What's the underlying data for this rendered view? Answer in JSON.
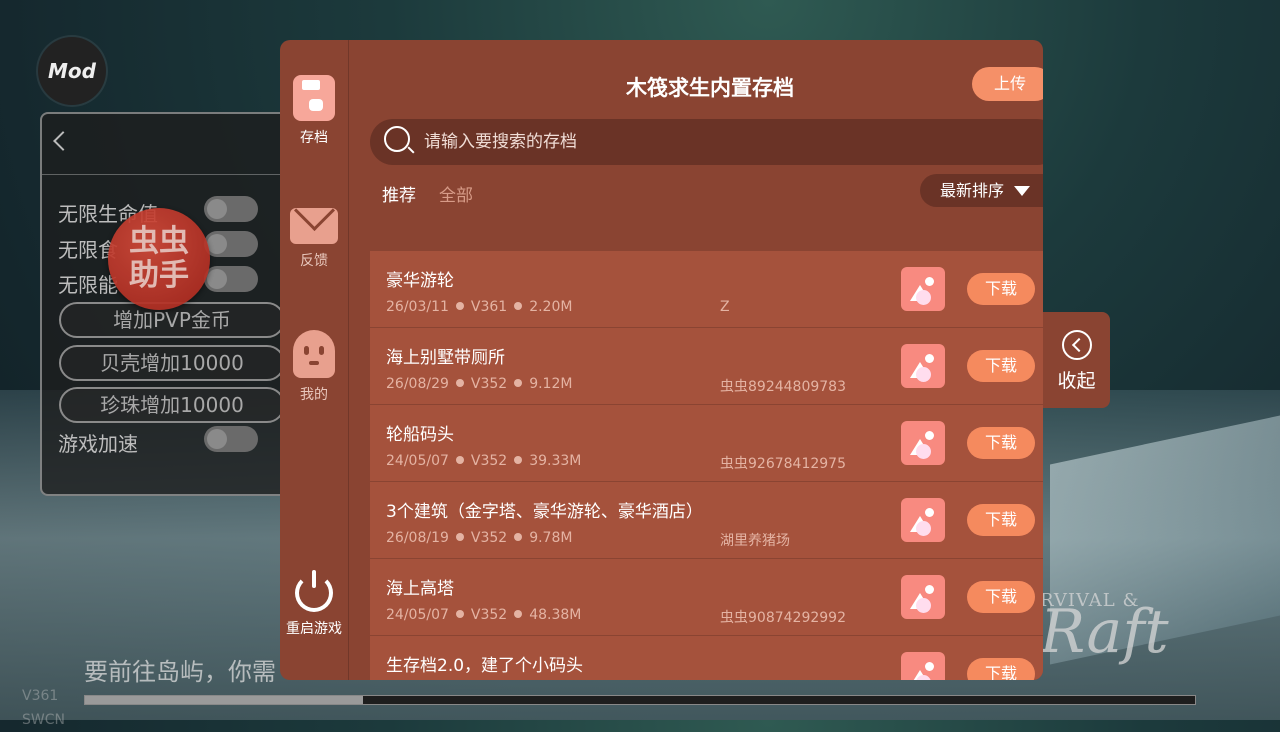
{
  "background": {
    "mod_badge": "Mod",
    "cheat_panel": {
      "toggles": [
        "无限生命值",
        "无限食",
        "无限能"
      ],
      "buttons": [
        "增加PVP金币",
        "贝壳增加10000",
        "珍珠增加10000"
      ],
      "speed_label": "游戏加速"
    },
    "cc_logo": "虫虫\n助手",
    "story_text": "要前往岛屿，你需",
    "version_line1": "V361",
    "version_line2": "SWCN",
    "progress_fraction": 0.25,
    "game_logo_small": "RVIVAL &",
    "game_logo_big": "Raft"
  },
  "side_nav": {
    "items": [
      {
        "label": "存档",
        "icon": "save-icon"
      },
      {
        "label": "反馈",
        "icon": "mail-icon"
      },
      {
        "label": "我的",
        "icon": "profile-icon"
      },
      {
        "label": "重启游戏",
        "icon": "power-icon"
      }
    ]
  },
  "header": {
    "title": "木筏求生内置存档",
    "upload_label": "上传"
  },
  "search": {
    "placeholder": "请输入要搜索的存档"
  },
  "tabs": {
    "recommended": "推荐",
    "all": "全部"
  },
  "sort": {
    "label": "最新排序"
  },
  "saves": [
    {
      "title": "豪华游轮",
      "date": "26/03/11",
      "version": "V361",
      "size": "2.20M",
      "author": "Z",
      "action": "下载"
    },
    {
      "title": "海上别墅带厕所",
      "date": "26/08/29",
      "version": "V352",
      "size": "9.12M",
      "author": "虫虫89244809783",
      "action": "下载"
    },
    {
      "title": "轮船码头",
      "date": "24/05/07",
      "version": "V352",
      "size": "39.33M",
      "author": "虫虫92678412975",
      "action": "下载"
    },
    {
      "title": "3个建筑（金字塔、豪华游轮、豪华酒店）",
      "date": "26/08/19",
      "version": "V352",
      "size": "9.78M",
      "author": "湖里养猪场",
      "action": "下载"
    },
    {
      "title": "海上高塔",
      "date": "24/05/07",
      "version": "V352",
      "size": "48.38M",
      "author": "虫虫90874292992",
      "action": "下载"
    },
    {
      "title": "生存档2.0，建了个小码头",
      "date": "",
      "version": "",
      "size": "",
      "author": "",
      "action": "下载"
    }
  ],
  "collapse": {
    "label": "收起"
  },
  "colors": {
    "panel": "#8a4432",
    "row": "#a5523c",
    "accent": "#f58a5e"
  }
}
